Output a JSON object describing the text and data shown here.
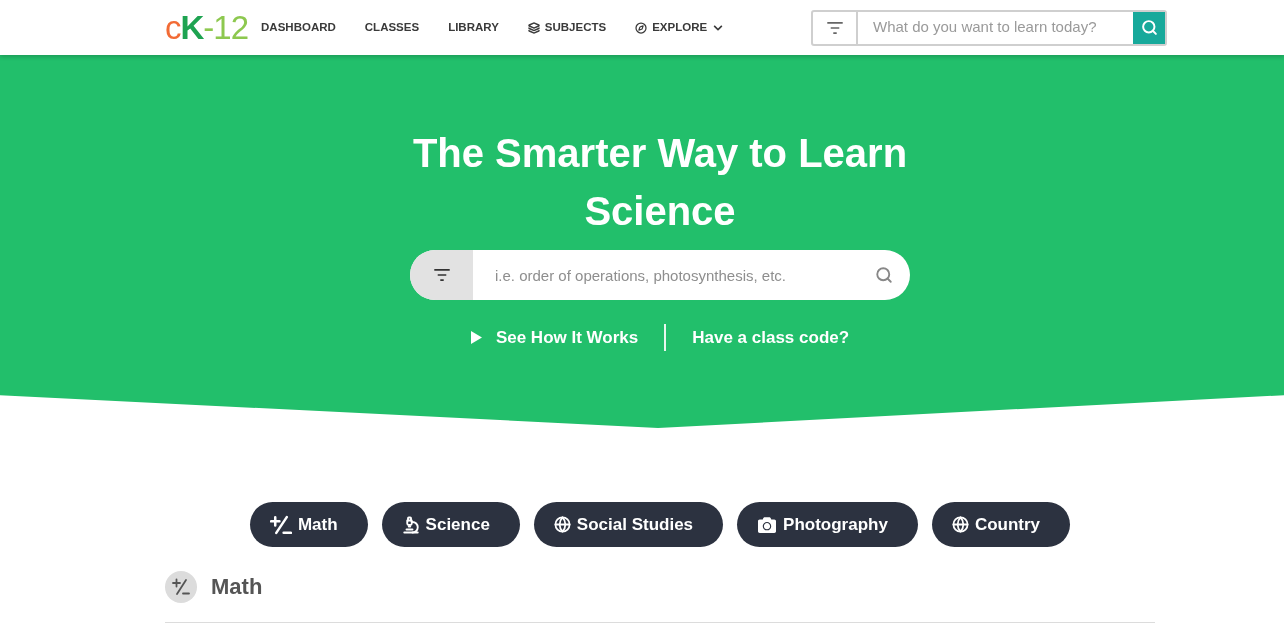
{
  "header": {
    "logo": "cK-12",
    "nav": [
      {
        "label": "DASHBOARD",
        "kind": "link"
      },
      {
        "label": "CLASSES",
        "kind": "link"
      },
      {
        "label": "LIBRARY",
        "kind": "link"
      },
      {
        "label": "SUBJECTS",
        "kind": "icon_link"
      },
      {
        "label": "EXPLORE",
        "kind": "menu"
      }
    ],
    "search": {
      "placeholder": "What do you want to learn today?"
    }
  },
  "hero": {
    "title": "The Smarter Way to Learn Science",
    "search": {
      "placeholder": "i.e. order of operations, photosynthesis, etc."
    },
    "links": [
      {
        "label": "See How It Works",
        "kind": "video"
      },
      {
        "label": "Have a class code?",
        "kind": "plain"
      }
    ]
  },
  "subject_pills": [
    {
      "label": "Math"
    },
    {
      "label": "Science"
    },
    {
      "label": "Social Studies"
    },
    {
      "label": "Photography"
    },
    {
      "label": "Country"
    }
  ],
  "section": {
    "title": "Math"
  }
}
